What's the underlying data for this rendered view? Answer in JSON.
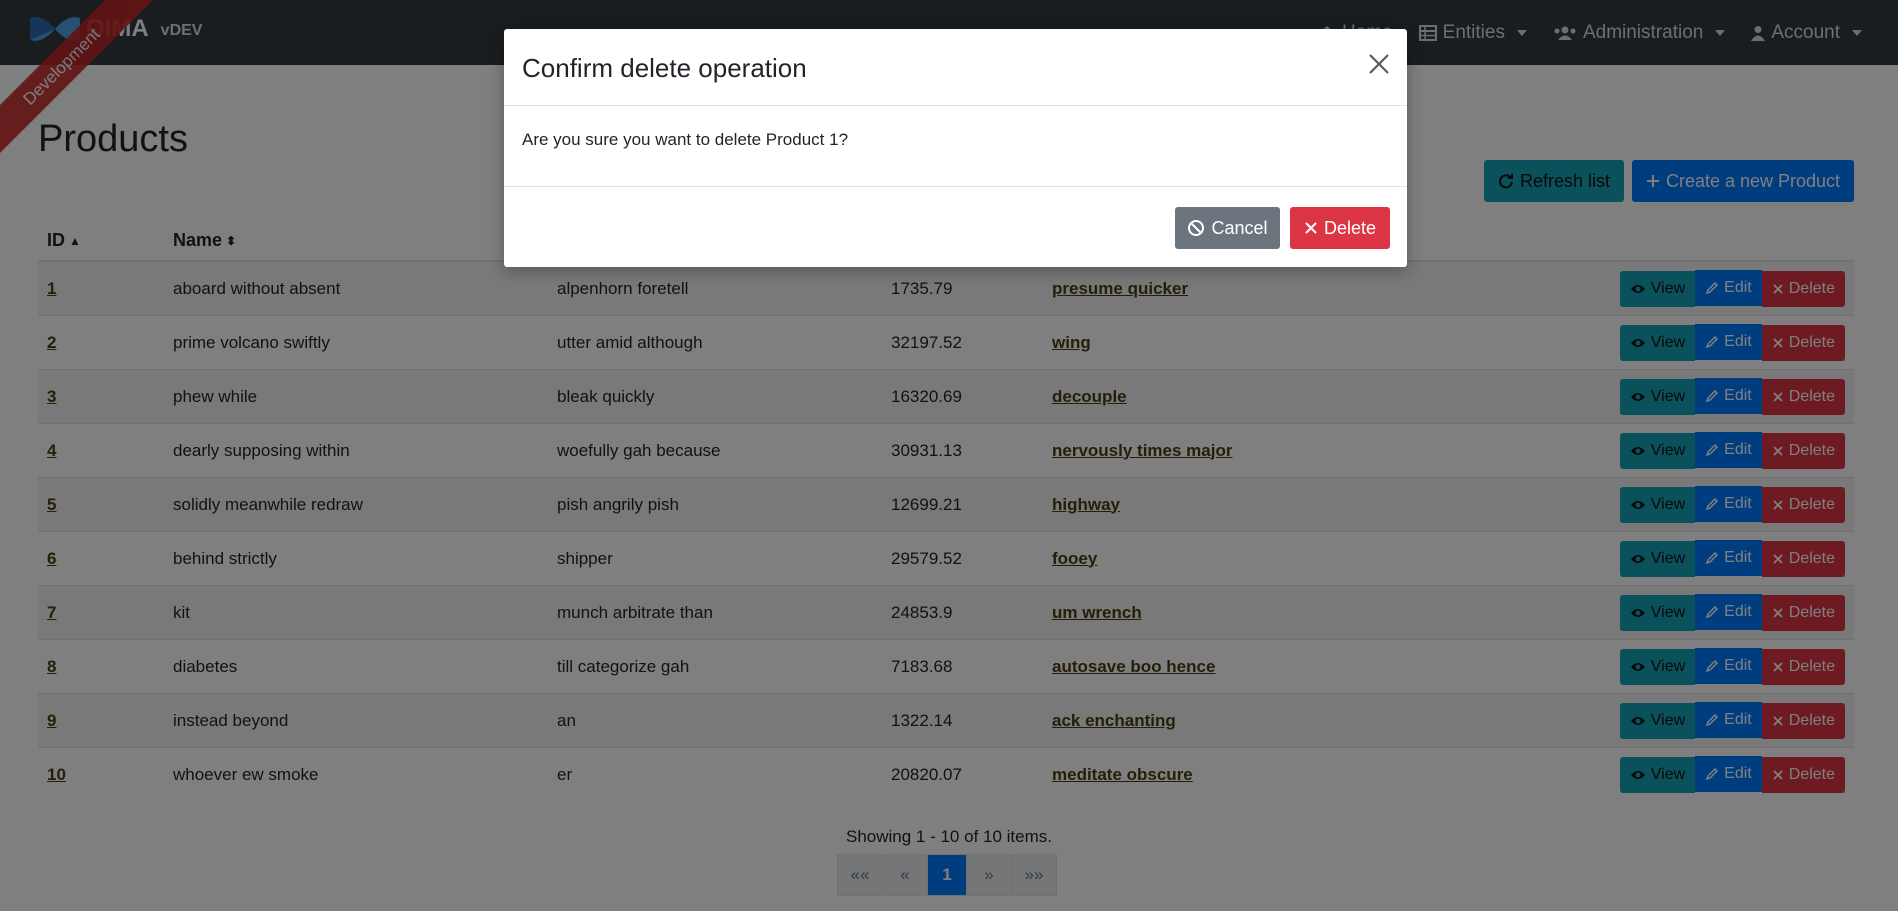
{
  "navbar": {
    "brand": "OIMA",
    "version": "vDEV",
    "ribbon": "Development",
    "items": [
      {
        "label": "Home",
        "icon": "home-icon"
      },
      {
        "label": "Entities",
        "icon": "table-icon"
      },
      {
        "label": "Administration",
        "icon": "users-icon"
      },
      {
        "label": "Account",
        "icon": "user-icon"
      }
    ]
  },
  "page": {
    "title": "Products",
    "refresh_label": "Refresh list",
    "create_label": "Create a new Product"
  },
  "table": {
    "headers": {
      "id": "ID",
      "name": "Name"
    },
    "rows": [
      {
        "id": "1",
        "name": "aboard without absent",
        "desc": "alpenhorn foretell",
        "price": "1735.79",
        "category": "presume quicker"
      },
      {
        "id": "2",
        "name": "prime volcano swiftly",
        "desc": "utter amid although",
        "price": "32197.52",
        "category": "wing"
      },
      {
        "id": "3",
        "name": "phew while",
        "desc": "bleak quickly",
        "price": "16320.69",
        "category": "decouple"
      },
      {
        "id": "4",
        "name": "dearly supposing within",
        "desc": "woefully gah because",
        "price": "30931.13",
        "category": "nervously times major"
      },
      {
        "id": "5",
        "name": "solidly meanwhile redraw",
        "desc": "pish angrily pish",
        "price": "12699.21",
        "category": "highway"
      },
      {
        "id": "6",
        "name": "behind strictly",
        "desc": "shipper",
        "price": "29579.52",
        "category": "fooey"
      },
      {
        "id": "7",
        "name": "kit",
        "desc": "munch arbitrate than",
        "price": "24853.9",
        "category": "um wrench"
      },
      {
        "id": "8",
        "name": "diabetes",
        "desc": "till categorize gah",
        "price": "7183.68",
        "category": "autosave boo hence"
      },
      {
        "id": "9",
        "name": "instead beyond",
        "desc": "an",
        "price": "1322.14",
        "category": "ack enchanting"
      },
      {
        "id": "10",
        "name": "whoever ew smoke",
        "desc": "er",
        "price": "20820.07",
        "category": "meditate obscure"
      }
    ],
    "actions": {
      "view": "View",
      "edit": "Edit",
      "delete": "Delete"
    }
  },
  "footer": {
    "showing": "Showing 1 - 10 of 10 items.",
    "pages": [
      "««",
      "«",
      "1",
      "»",
      "»»"
    ],
    "current_page": "1"
  },
  "modal": {
    "title": "Confirm delete operation",
    "body": "Are you sure you want to delete Product 1?",
    "cancel_label": "Cancel",
    "delete_label": "Delete"
  },
  "colors": {
    "navbar": "#343a40",
    "info": "#17a2b8",
    "primary": "#007bff",
    "danger": "#dc3545",
    "secondary": "#6c757d"
  }
}
